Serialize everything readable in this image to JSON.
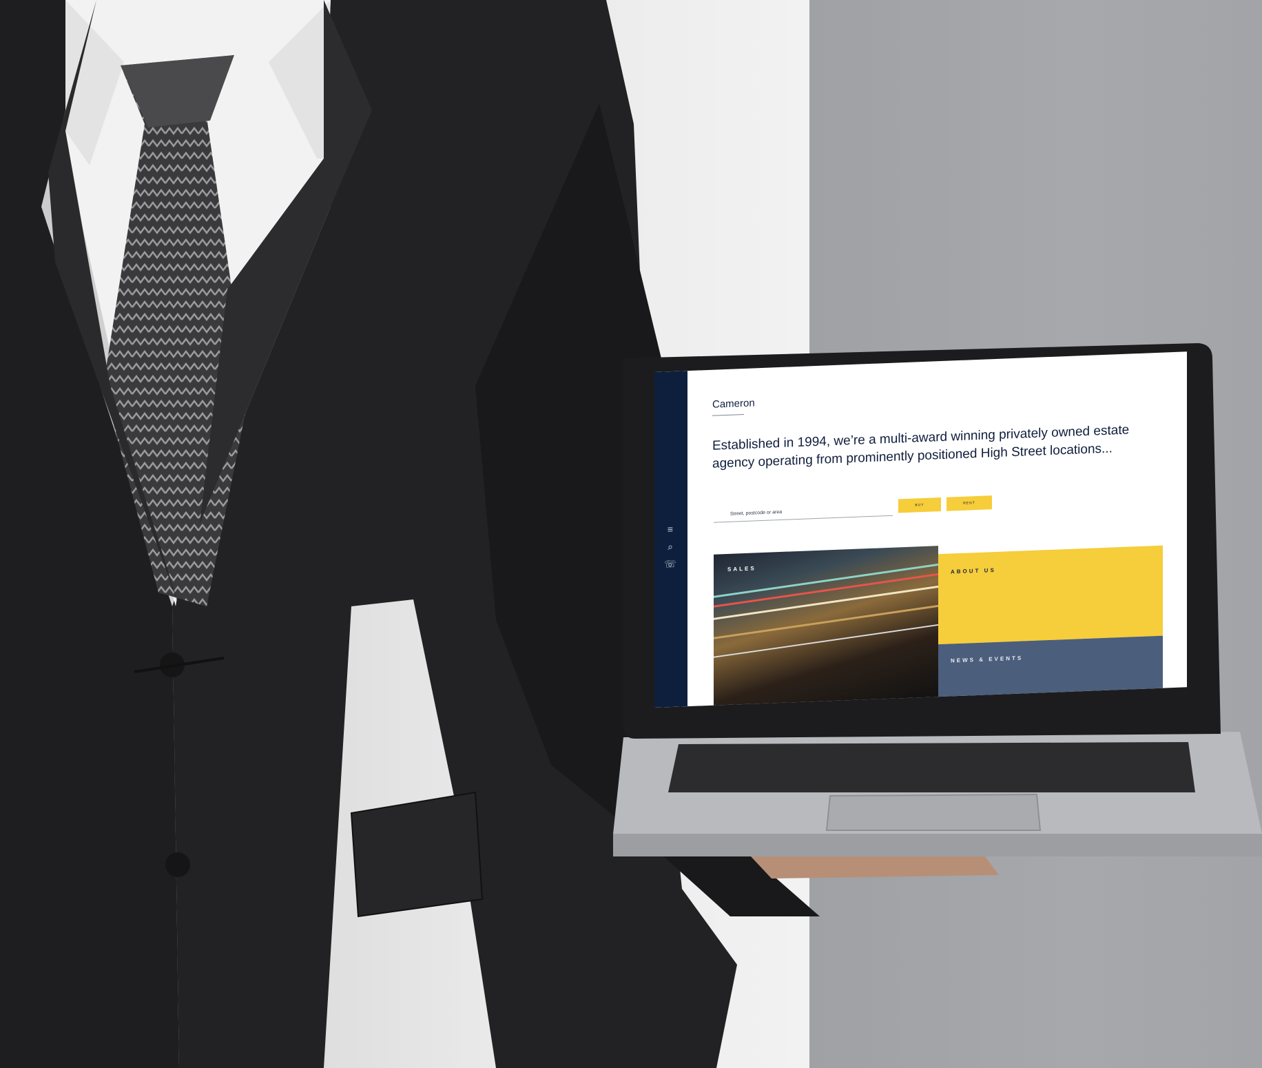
{
  "scene": {
    "background_left_color": "#e6e6e6",
    "background_right_color": "#a3a5a8",
    "suit_color": "#1d1d1f",
    "shirt_color": "#f3f3f3",
    "laptop_color": "#b5b7bb"
  },
  "website": {
    "brand": "Cameron",
    "intro": "Established in 1994, we’re a multi-award winning privately owned estate agency operating from prominently positioned High Street locations...",
    "search_placeholder": "Street, postcode or area",
    "buy_label": "BUY",
    "rent_label": "RENT",
    "sidebar_icons": [
      "menu-icon",
      "search-icon",
      "phone-icon"
    ],
    "tiles": {
      "sales": "SALES",
      "about": "ABOUT US",
      "news": "NEWS & EVENTS"
    },
    "colors": {
      "navy": "#0e1f3e",
      "yellow": "#f6cd3a",
      "slate": "#4b5e7c"
    }
  }
}
